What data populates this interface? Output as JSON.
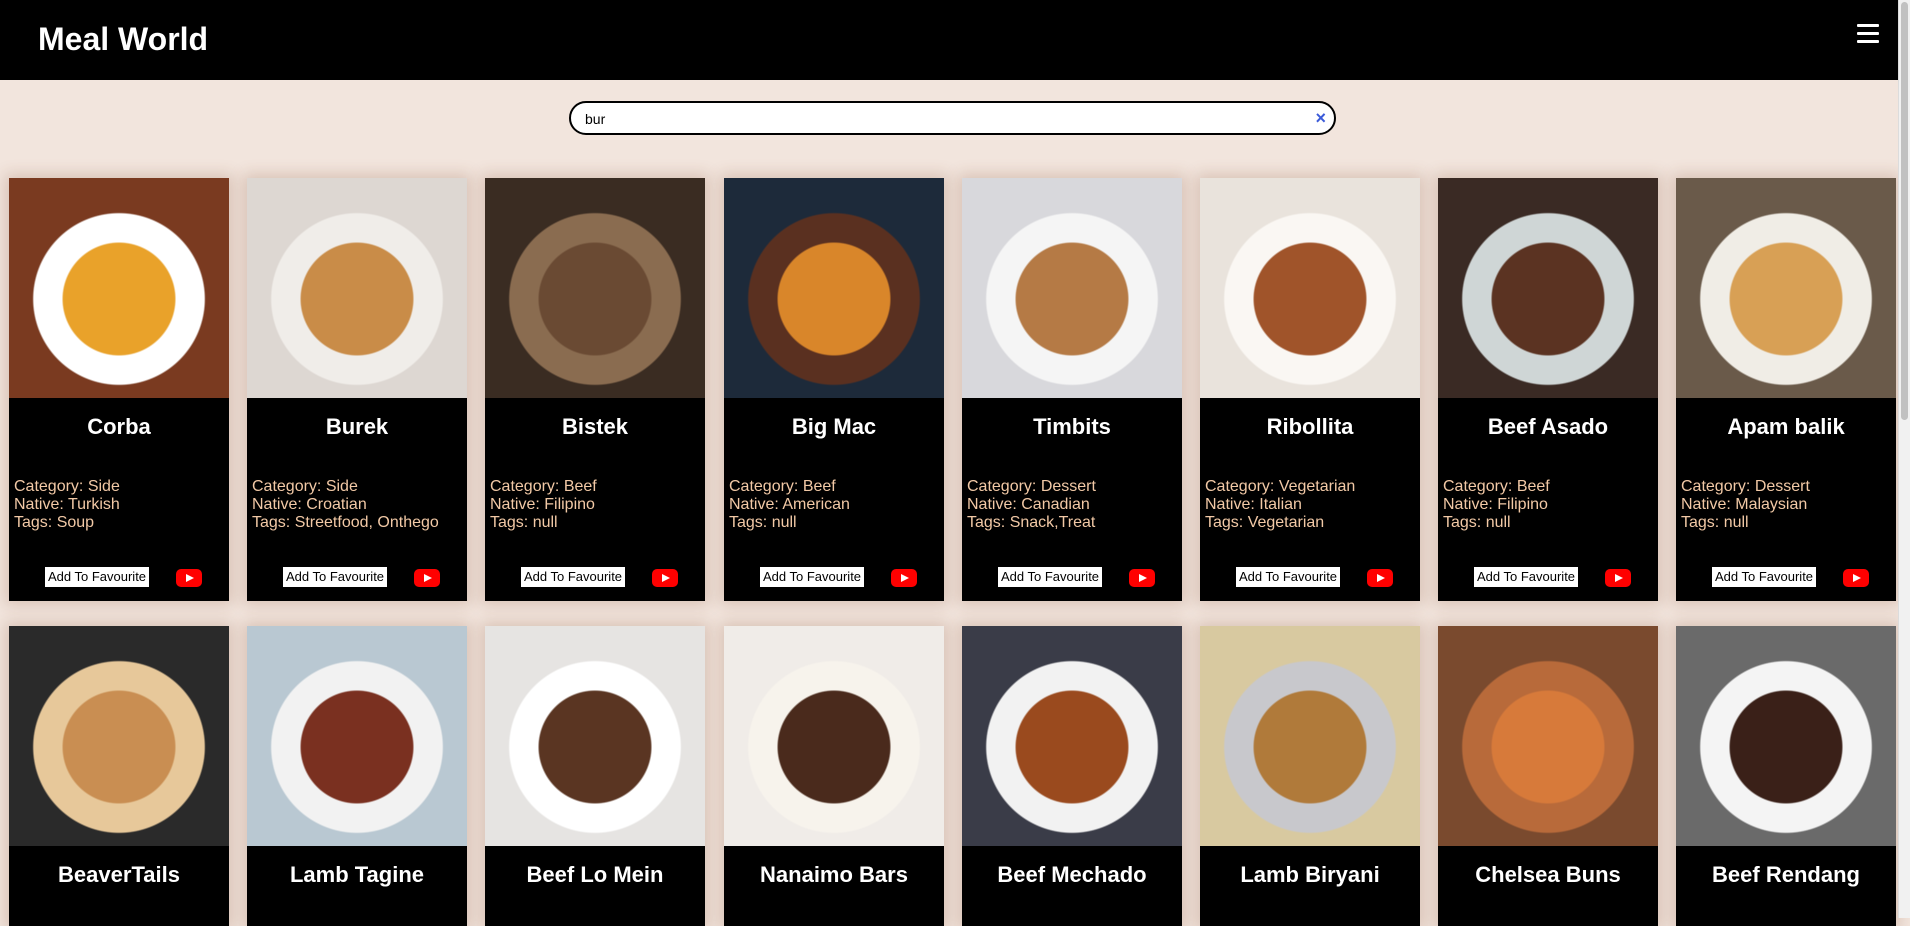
{
  "navbar": {
    "brand": "Meal World",
    "menu_icon": "hamburger-menu-icon"
  },
  "search": {
    "value": "bur",
    "clear_icon": "close-icon"
  },
  "card_labels": {
    "favourite": "Add To Favourite",
    "video_icon": "youtube-icon"
  },
  "meals": [
    {
      "name": "Corba",
      "category": "Category: Side",
      "native": "Native: Turkish",
      "tags": "Tags: Soup",
      "colors": [
        "#7a3a20",
        "#e9a22a",
        "#ffffff"
      ]
    },
    {
      "name": "Burek",
      "category": "Category: Side",
      "native": "Native: Croatian",
      "tags": "Tags: Streetfood, Onthego",
      "colors": [
        "#ddd7d2",
        "#c98c48",
        "#f0ede9"
      ]
    },
    {
      "name": "Bistek",
      "category": "Category: Beef",
      "native": "Native: Filipino",
      "tags": "Tags: null",
      "colors": [
        "#3a2c22",
        "#6a4a33",
        "#8a6c50"
      ]
    },
    {
      "name": "Big Mac",
      "category": "Category: Beef",
      "native": "Native: American",
      "tags": "Tags: null",
      "colors": [
        "#1d2a3a",
        "#d9862a",
        "#5a3020"
      ]
    },
    {
      "name": "Timbits",
      "category": "Category: Dessert",
      "native": "Native: Canadian",
      "tags": "Tags: Snack,Treat",
      "colors": [
        "#d8d8dc",
        "#b57a45",
        "#f5f5f5"
      ]
    },
    {
      "name": "Ribollita",
      "category": "Category: Vegetarian",
      "native": "Native: Italian",
      "tags": "Tags: Vegetarian",
      "colors": [
        "#e9e3dc",
        "#a0542a",
        "#faf7f3"
      ]
    },
    {
      "name": "Beef Asado",
      "category": "Category: Beef",
      "native": "Native: Filipino",
      "tags": "Tags: null",
      "colors": [
        "#3a2a24",
        "#5b3322",
        "#cfd6d6"
      ]
    },
    {
      "name": "Apam balik",
      "category": "Category: Dessert",
      "native": "Native: Malaysian",
      "tags": "Tags: null",
      "colors": [
        "#6a5a4a",
        "#d8a055",
        "#f0ede6"
      ]
    },
    {
      "name": "BeaverTails",
      "colors": [
        "#2a2a2a",
        "#c98e52",
        "#e7c89a"
      ]
    },
    {
      "name": "Lamb Tagine",
      "colors": [
        "#b9c8d2",
        "#7a3020",
        "#f2f2f2"
      ]
    },
    {
      "name": "Beef Lo Mein",
      "colors": [
        "#e6e4e2",
        "#5a3522",
        "#ffffff"
      ]
    },
    {
      "name": "Nanaimo Bars",
      "colors": [
        "#f0ece8",
        "#4a2a1c",
        "#f7f3ec"
      ]
    },
    {
      "name": "Beef Mechado",
      "colors": [
        "#3a3c48",
        "#9a4a1e",
        "#f2f2f2"
      ]
    },
    {
      "name": "Lamb Biryani",
      "colors": [
        "#d8c9a0",
        "#b07a3a",
        "#c8c8cc"
      ]
    },
    {
      "name": "Chelsea Buns",
      "colors": [
        "#7a4a2e",
        "#d77a3a",
        "#b86a3a"
      ]
    },
    {
      "name": "Beef Rendang",
      "colors": [
        "#6a6a6a",
        "#3a2018",
        "#f4f4f4"
      ]
    }
  ]
}
